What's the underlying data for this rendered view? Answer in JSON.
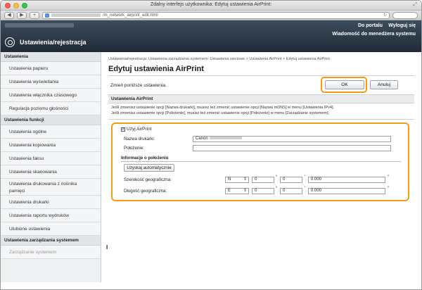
{
  "window": {
    "title": "Zdalny interfejs użytkownika: Edytuj ustawienia AirPrint:",
    "url": "/m_network_airprint_edit.html"
  },
  "header": {
    "portal_link": "Do portalu",
    "logout_link": "Wyloguj się",
    "message_link": "Wiadomość do menedżera systemu",
    "title": "Ustawienia/rejestracja"
  },
  "sidebar": {
    "section1": "Ustawienia",
    "items1": [
      "Ustawienia papieru",
      "Ustawienia wyświetlania",
      "Ustawienia włącznika czasowego",
      "Regulacja poziomu głośności"
    ],
    "section2": "Ustawienia funkcji",
    "items2": [
      "Ustawienia ogólne",
      "Ustawienia kopiowania",
      "Ustawienia faksu",
      "Ustawienia skanowania",
      "Ustawienia drukowania z nośnika pamięci",
      "Ustawienia drukarki",
      "Ustawienia raportu wydruków",
      "Ulubione ustawienia"
    ],
    "section3": "Ustawienia zarządzania systemem",
    "items3": [
      "Zarządzanie systemem"
    ]
  },
  "content": {
    "breadcrumb": "Ustawienia/rejestracja: Ustawienia zarządzania systemem: Ustawienia sieciowe > Ustawienia AirPrint > Edytuj ustawienia AirPrint",
    "page_title": "Edytuj ustawienia AirPrint",
    "instruction": "Zmień poniższe ustawienia.",
    "ok_label": "OK",
    "cancel_label": "Anuluj",
    "section_title": "Ustawienia AirPrint",
    "note_line1": "Jeśli zmienisz ustawienie opcji [Nazwa drukarki], musisz też zmienić ustawienie opcji [Nazwa mDNS] w menu [Ustawienia IPv4].",
    "note_line2": "Jeśli zmienisz ustawienie opcji [Położenie], musisz też zmienić ustawienie opcji [Położenie] w menu [Zarządzanie systemem].",
    "use_airprint_label": "Użyj AirPrint",
    "use_airprint_checked": true,
    "printer_name_label": "Nazwa drukarki:",
    "printer_name_value": "Canon",
    "location_label": "Położenie:",
    "location_value": "",
    "geo_section_title": "Informacje o położeniu",
    "auto_get_button": "Uzyskaj automatycznie",
    "latitude_label": "Szerokość geograficzna:",
    "latitude_dir": "N",
    "latitude_deg": "0",
    "latitude_min": "0",
    "latitude_sec": "0.000",
    "longitude_label": "Długość geograficzna:",
    "longitude_dir": "E",
    "longitude_deg": "0",
    "longitude_min": "0",
    "longitude_sec": "0.000",
    "deg_symbol": "°",
    "min_symbol": "'",
    "sec_symbol": "\"",
    "bottom_mark": "Ι"
  },
  "colors": {
    "highlight": "#f39c12",
    "header_bg": "#2b3847"
  }
}
